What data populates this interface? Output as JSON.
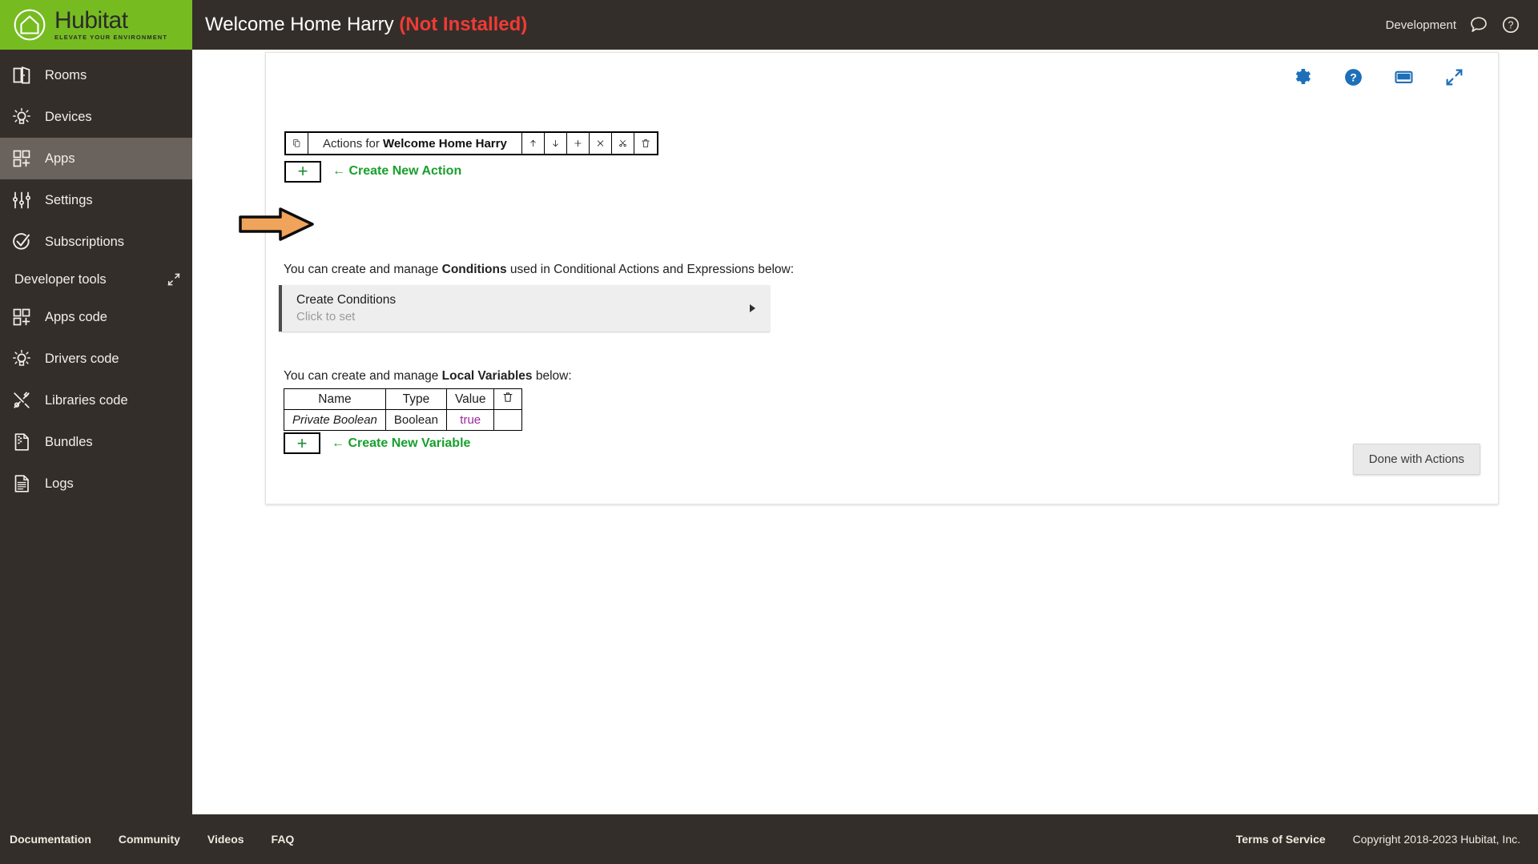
{
  "brand": {
    "name": "Hubitat",
    "tagline": "ELEVATE YOUR ENVIRONMENT",
    "green": "#76bc21",
    "dark": "#342e2a"
  },
  "topbar": {
    "title": "Welcome Home Harry",
    "status": "(Not Installed)",
    "status_color": "#ef3b36",
    "environment": "Development",
    "icons": [
      "chat-bubble-icon",
      "help-circle-icon"
    ]
  },
  "sidebar": {
    "items": [
      {
        "label": "Rooms",
        "icon": "rooms-door-icon",
        "active": false
      },
      {
        "label": "Devices",
        "icon": "lightbulb-icon",
        "active": false
      },
      {
        "label": "Apps",
        "icon": "apps-grid-icon",
        "active": true
      },
      {
        "label": "Settings",
        "icon": "sliders-icon",
        "active": false
      },
      {
        "label": "Subscriptions",
        "icon": "check-circle-icon",
        "active": false
      }
    ],
    "section": {
      "label": "Developer tools",
      "collapse_icon": "collapse-arrows-icon",
      "items": [
        {
          "label": "Apps code",
          "icon": "apps-grid-icon"
        },
        {
          "label": "Drivers code",
          "icon": "lightbulb-icon"
        },
        {
          "label": "Libraries code",
          "icon": "tools-icon"
        },
        {
          "label": "Bundles",
          "icon": "zip-file-icon"
        },
        {
          "label": "Logs",
          "icon": "document-icon"
        }
      ]
    }
  },
  "card": {
    "tool_icons": [
      "gear-icon",
      "help-icon",
      "display-icon",
      "expand-icon"
    ],
    "tool_color": "#1d6fb8",
    "actions": {
      "copy_icon": "copy-icon",
      "title_prefix": "Actions for ",
      "title_name": "Welcome Home Harry",
      "buttons": [
        "move-up-icon",
        "move-down-icon",
        "add-icon",
        "close-icon",
        "cut-icon",
        "delete-icon"
      ],
      "plus_label": "+",
      "create_label": "← Create New Action"
    },
    "conditions": {
      "intro_a": "You can create and manage ",
      "intro_b": "Conditions",
      "intro_c": " used in Conditional Actions and Expressions below:",
      "title": "Create Conditions",
      "subtitle": "Click to set"
    },
    "variables": {
      "intro_a": "You can create and manage ",
      "intro_b": "Local Variables",
      "intro_c": " below:",
      "columns": [
        "Name",
        "Type",
        "Value"
      ],
      "delete_header_icon": "trash-icon",
      "rows": [
        {
          "name": "Private Boolean",
          "type": "Boolean",
          "value": "true"
        }
      ],
      "value_color": "#9c27a0",
      "plus_label": "+",
      "create_label": "← Create New Variable"
    },
    "done_label": "Done with Actions"
  },
  "annotation": {
    "type": "arrow-annotation",
    "color": "#f0a050",
    "points_to": "add-action-plus-button"
  },
  "footer": {
    "left_links": [
      "Documentation",
      "Community",
      "Videos",
      "FAQ"
    ],
    "right_links": [
      "Terms of Service"
    ],
    "copyright": "Copyright 2018-2023 Hubitat, Inc."
  }
}
